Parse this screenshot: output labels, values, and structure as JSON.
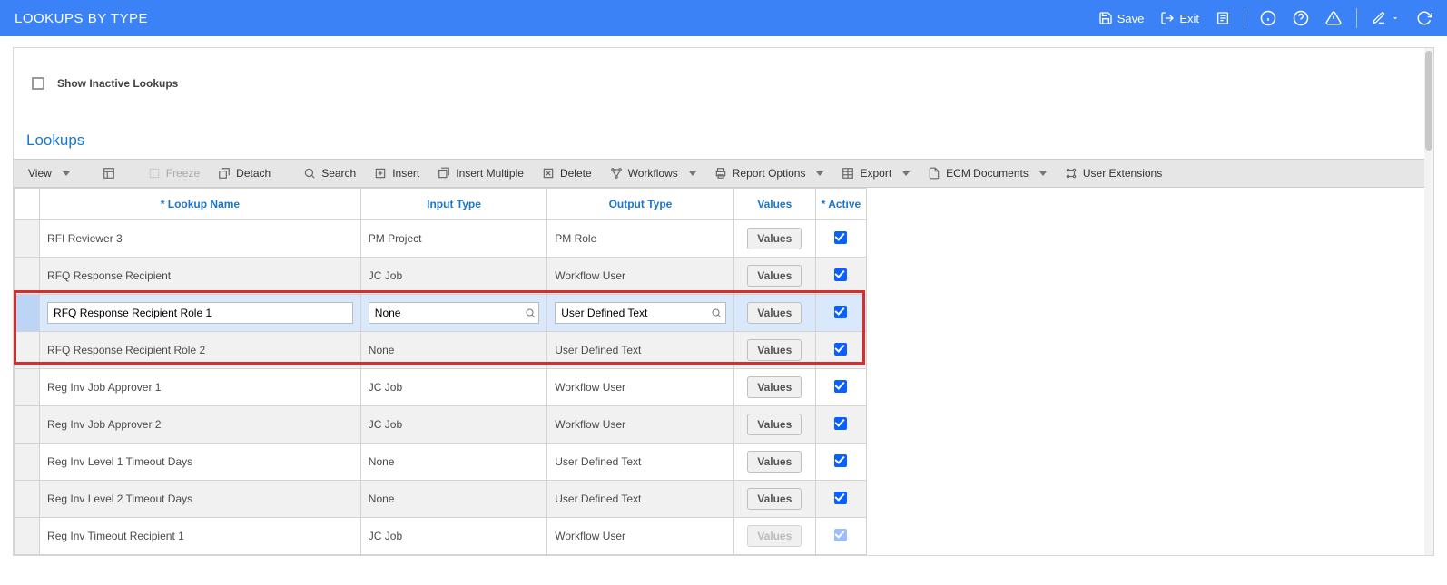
{
  "header": {
    "title": "LOOKUPS BY TYPE",
    "save": "Save",
    "exit": "Exit"
  },
  "inactive_checkbox_label": "Show Inactive Lookups",
  "section_title": "Lookups",
  "toolbar": {
    "view": "View",
    "freeze": "Freeze",
    "detach": "Detach",
    "search": "Search",
    "insert": "Insert",
    "insert_multiple": "Insert Multiple",
    "delete": "Delete",
    "workflows": "Workflows",
    "report_options": "Report Options",
    "export": "Export",
    "ecm_documents": "ECM Documents",
    "user_extensions": "User Extensions"
  },
  "columns": {
    "name": "* Lookup Name",
    "input": "Input Type",
    "output": "Output Type",
    "values": "Values",
    "active": "* Active"
  },
  "values_btn": "Values",
  "rows": [
    {
      "name": "RFI Reviewer 3",
      "input": "PM Project",
      "output": "PM Role",
      "active": true
    },
    {
      "name": "RFQ Response Recipient",
      "input": "JC Job",
      "output": "Workflow User",
      "active": true
    },
    {
      "name": "RFQ Response Recipient Role 1",
      "input": "None",
      "output": "User Defined Text",
      "active": true
    },
    {
      "name": "RFQ Response Recipient Role 2",
      "input": "None",
      "output": "User Defined Text",
      "active": true
    },
    {
      "name": "Reg Inv Job Approver 1",
      "input": "JC Job",
      "output": "Workflow User",
      "active": true
    },
    {
      "name": "Reg Inv Job Approver 2",
      "input": "JC Job",
      "output": "Workflow User",
      "active": true
    },
    {
      "name": "Reg Inv Level 1 Timeout Days",
      "input": "None",
      "output": "User Defined Text",
      "active": true
    },
    {
      "name": "Reg Inv Level 2 Timeout Days",
      "input": "None",
      "output": "User Defined Text",
      "active": true
    },
    {
      "name": "Reg Inv Timeout Recipient 1",
      "input": "JC Job",
      "output": "Workflow User",
      "active": true
    }
  ]
}
